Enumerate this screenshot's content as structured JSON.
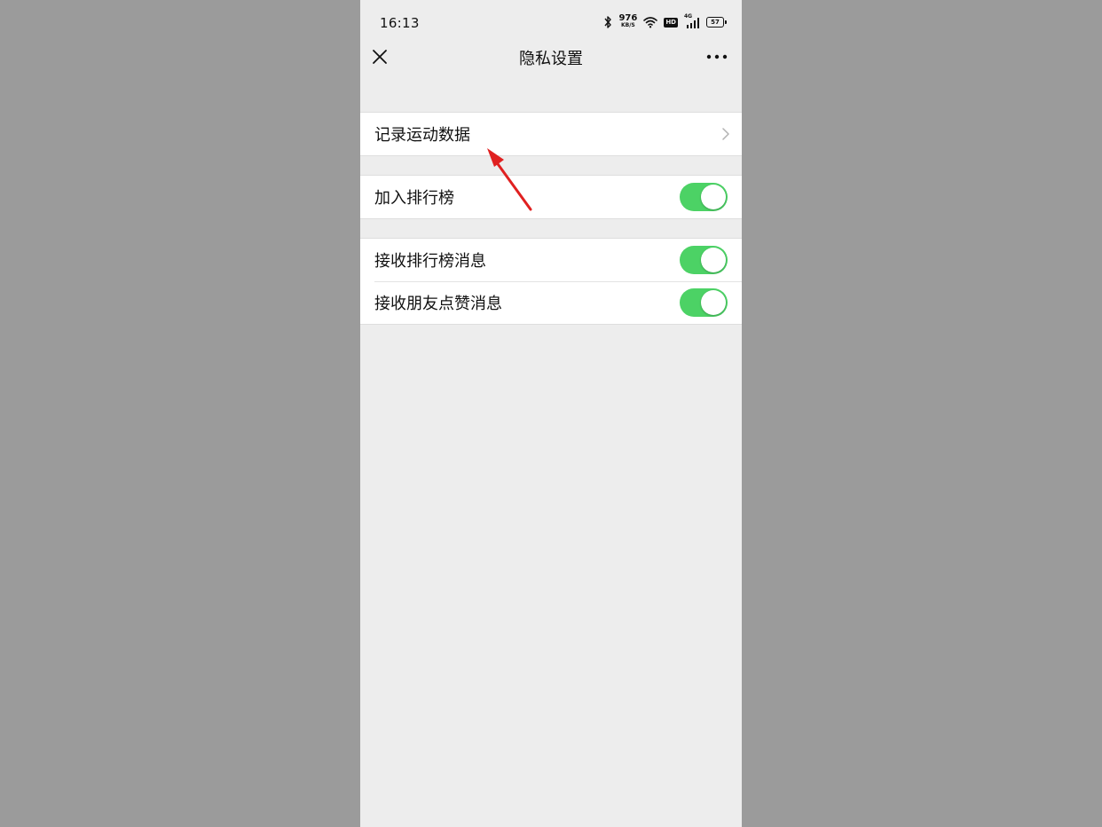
{
  "status_bar": {
    "time": "16:13",
    "net_speed_value": "976",
    "net_speed_unit": "KB/S",
    "hd_label": "HD",
    "cell_label": "4G",
    "battery": "57"
  },
  "nav": {
    "title": "隐私设置",
    "close_icon": "close-icon",
    "more_icon": "more-icon"
  },
  "groups": [
    {
      "rows": [
        {
          "label": "记录运动数据",
          "type": "link"
        }
      ]
    },
    {
      "rows": [
        {
          "label": "加入排行榜",
          "type": "toggle",
          "on": true
        }
      ]
    },
    {
      "rows": [
        {
          "label": "接收排行榜消息",
          "type": "toggle",
          "on": true
        },
        {
          "label": "接收朋友点赞消息",
          "type": "toggle",
          "on": true
        }
      ]
    }
  ],
  "colors": {
    "toggle_on": "#4cd265",
    "background": "#ededed",
    "annotation_arrow": "#e02020"
  }
}
